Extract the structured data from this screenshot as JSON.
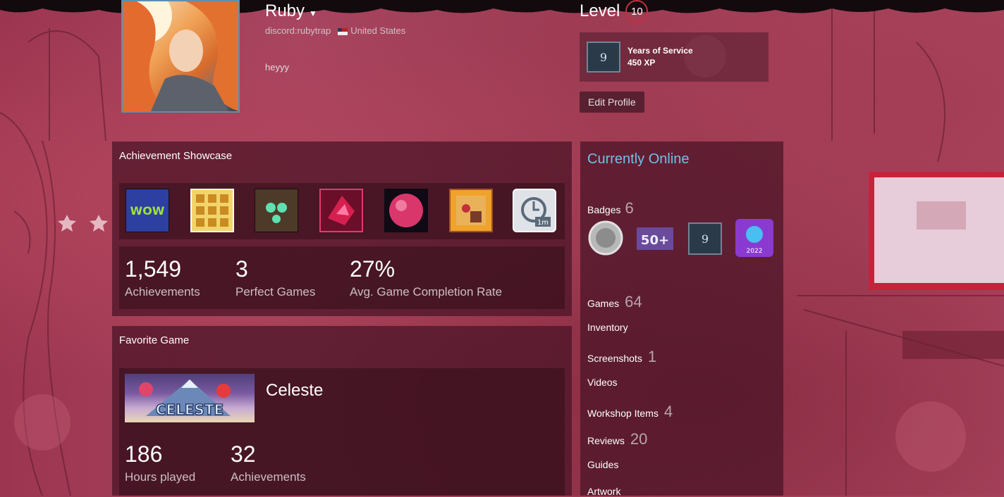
{
  "profile": {
    "name": "Ruby",
    "alias": "discord:rubytrap",
    "country": "United States",
    "summary": "heyyy"
  },
  "level": {
    "label": "Level",
    "value": "10",
    "badge_name": "Years of Service",
    "badge_xp": "450 XP",
    "badge_number": "9"
  },
  "edit_profile": "Edit Profile",
  "achievement_showcase": {
    "title": "Achievement Showcase",
    "icons": [
      "wow-achievement-icon",
      "golden-blocks-achievement-icon",
      "jungle-totem-achievement-icon",
      "crystal-heart-achievement-icon",
      "pink-orb-achievement-icon",
      "strawberry-portrait-achievement-icon",
      "timer-1m-achievement-icon"
    ],
    "stats": [
      {
        "value": "1,549",
        "label": "Achievements"
      },
      {
        "value": "3",
        "label": "Perfect Games"
      },
      {
        "value": "27%",
        "label": "Avg. Game Completion Rate"
      }
    ]
  },
  "favorite_game": {
    "title": "Favorite Game",
    "logo_text": "CELESTE",
    "name": "Celeste",
    "stats": [
      {
        "value": "186",
        "label": "Hours played"
      },
      {
        "value": "32",
        "label": "Achievements"
      }
    ]
  },
  "sidebar": {
    "status": "Currently Online",
    "badges_label": "Badges",
    "badges_count": "6",
    "badge_icons": {
      "silver": "silver-badge-icon",
      "fifty_label": "50+",
      "years_number": "9",
      "year_label": "2022"
    },
    "links": [
      {
        "label": "Games",
        "count": "64"
      },
      {
        "label": "Inventory",
        "count": ""
      },
      {
        "label": "Screenshots",
        "count": "1"
      },
      {
        "label": "Videos",
        "count": ""
      },
      {
        "label": "Workshop Items",
        "count": "4"
      },
      {
        "label": "Reviews",
        "count": "20"
      },
      {
        "label": "Guides",
        "count": ""
      },
      {
        "label": "Artwork",
        "count": ""
      }
    ]
  },
  "colors": {
    "accent_online": "#6ec0e8",
    "level_ring": "#c3303c",
    "background": "#9c3550"
  }
}
